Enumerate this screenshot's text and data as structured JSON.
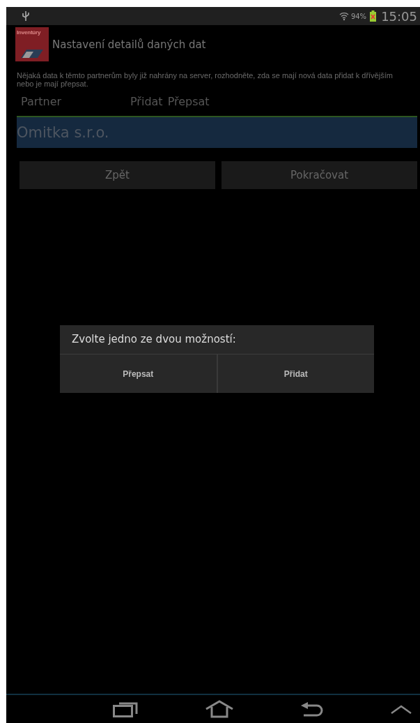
{
  "status_bar": {
    "battery": "94%",
    "time": "15:05"
  },
  "header": {
    "app_icon_label": "Inventúry",
    "title": "Nastavení detailů daných dat"
  },
  "message": "Nějaká data k těmto partnerům byly již nahrány na server, rozhodněte, zda se mají nová data přidat k dřívějším nebo je mají přepsat.",
  "table": {
    "columns": [
      "Partner",
      "Přidat",
      "Přepsat"
    ],
    "rows": [
      {
        "partner": "Omitka s.r.o.",
        "selected": true
      }
    ]
  },
  "buttons": [
    "Zpět",
    "Pokračovat"
  ],
  "dialog": {
    "title": "Zvolte jedno ze dvou možností:",
    "buttons": [
      "Přepsat",
      "Přidat"
    ]
  }
}
